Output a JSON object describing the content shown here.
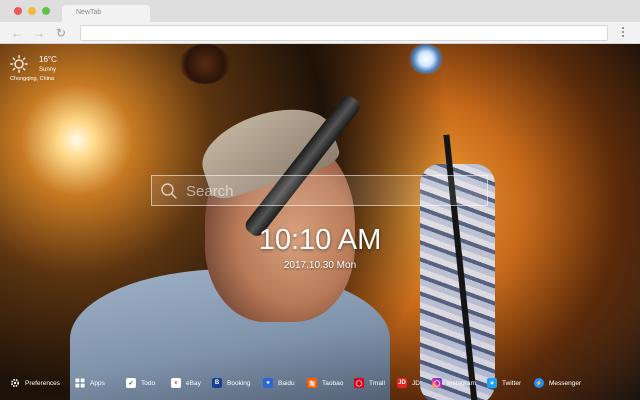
{
  "browser": {
    "tab_title": "NewTab",
    "address": ""
  },
  "icons": {
    "back": "back-arrow-icon",
    "forward": "forward-arrow-icon",
    "reload": "reload-icon",
    "menu": "kebab-menu-icon"
  },
  "weather": {
    "temperature": "16°C",
    "condition": "Sunny",
    "location": "Chongqing, China",
    "icon": "sun-icon"
  },
  "search": {
    "placeholder": "Search"
  },
  "clock": {
    "time": "10:10 AM",
    "date": "2017.10.30 Mon"
  },
  "bottom_bar": {
    "preferences": "Preferences",
    "apps": "Apps",
    "todo": "Todo",
    "ebay": "eBay",
    "booking": "Booking",
    "baidu": "Baidu",
    "taobao": "Taobao",
    "tmall": "Tmall",
    "jd": "JD",
    "instagram": "Instagram",
    "twitter": "Twitter",
    "messenger": "Messenger"
  },
  "colors": {
    "booking": "#1b3f8f",
    "baidu": "#2a66d8",
    "taobao": "#ff5a00",
    "tmall": "#d8001b",
    "jd": "#e1251b",
    "instagram": "#d6249f",
    "twitter": "#1da1f2",
    "messenger": "#1a8cff"
  }
}
